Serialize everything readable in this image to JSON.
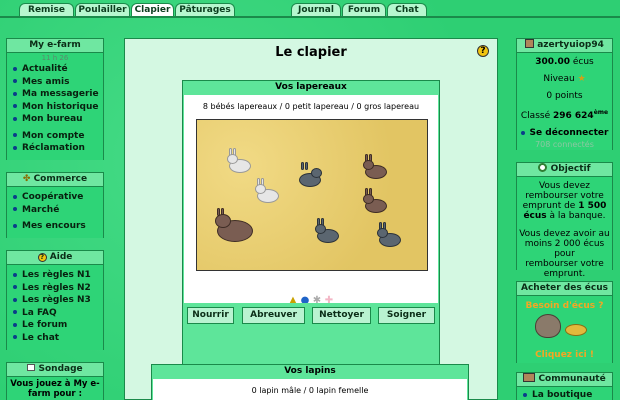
{
  "tabs": {
    "remise": "Remise",
    "poulailler": "Poulailler",
    "clapier": "Clapier",
    "paturages": "Pâturages",
    "journal": "Journal",
    "forum": "Forum",
    "chat": "Chat"
  },
  "left": {
    "myefarm": {
      "title": "My e-farm",
      "time": "11 h 26",
      "items": [
        "Actualité",
        "Mes amis",
        "Ma messagerie",
        "Mon historique",
        "Mon bureau"
      ],
      "items2": [
        "Mon compte",
        "Réclamation"
      ]
    },
    "commerce": {
      "title": "Commerce",
      "items": [
        "Coopérative",
        "Marché"
      ],
      "items2": [
        "Mes encours"
      ]
    },
    "aide": {
      "title": "Aide",
      "items": [
        "Les règles N1",
        "Les règles N2",
        "Les règles N3",
        "La FAQ",
        "Le forum",
        "Le chat"
      ]
    },
    "sondage": {
      "title": "Sondage",
      "text1": "Vous jouez à My e-",
      "text2": "farm pour :"
    }
  },
  "main": {
    "title": "Le clapier",
    "help_icon": "?",
    "lapereaux": {
      "title": "Vos lapereaux",
      "count": "8 bébés lapereaux / 0 petit lapereau / 0 gros lapereau",
      "buttons": [
        "Nourrir",
        "Abreuver",
        "Nettoyer",
        "Soigner"
      ]
    },
    "lapins": {
      "title": "Vos lapins",
      "count": "0 lapin mâle / 0 lapin femelle"
    }
  },
  "right": {
    "user": {
      "name": "azertyuiop94",
      "ecus": "300.00",
      "ecus_unit": "écus",
      "niveau": "Niveau",
      "points": "0 points",
      "classe_label": "Classé",
      "classe_value": "296 624",
      "classe_sup": "ème",
      "logout": "Se déconnecter",
      "connected": "708 connectés"
    },
    "objectif": {
      "title": "Objectif",
      "lines": [
        "Vous devez",
        "rembourser votre",
        "emprunt de"
      ],
      "amount": "1 500",
      "amount_unit": "écus",
      "after": "à la banque.",
      "lines2": [
        "Vous devez avoir au",
        "moins 2 000 écus pour",
        "rembourser votre",
        "emprunt."
      ]
    },
    "acheter": {
      "title": "Acheter des écus",
      "besoin": "Besoin d'écus ?",
      "cliquez": "Cliquez ici !"
    },
    "communaute": {
      "title": "Communauté",
      "item": "La boutique"
    }
  }
}
